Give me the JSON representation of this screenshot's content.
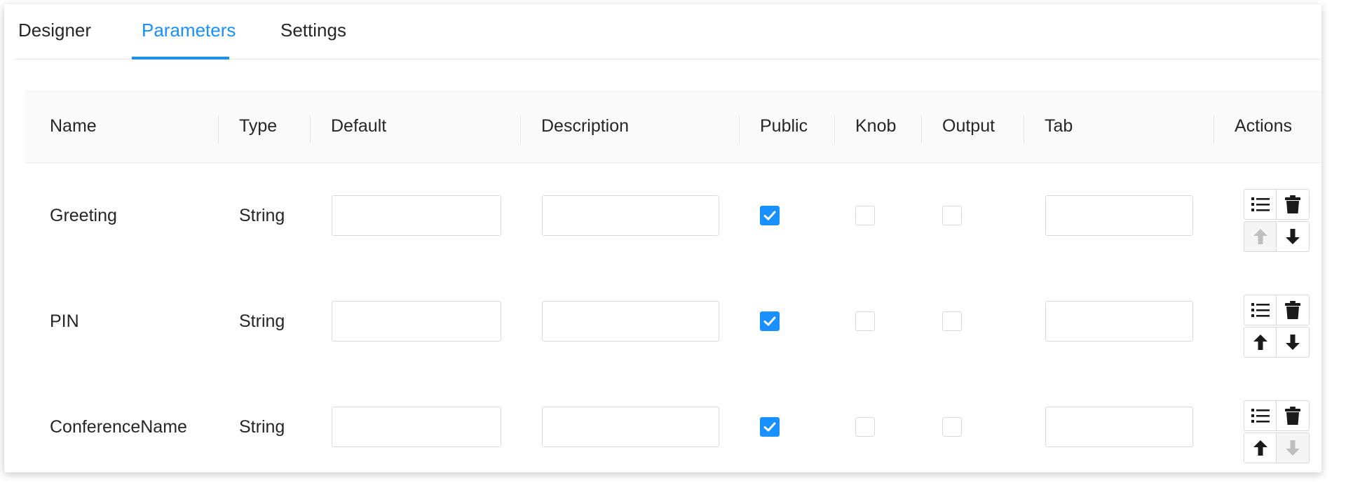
{
  "tabs": [
    {
      "label": "Designer",
      "active": false
    },
    {
      "label": "Parameters",
      "active": true
    },
    {
      "label": "Settings",
      "active": false
    }
  ],
  "table": {
    "columns": [
      "Name",
      "Type",
      "Default",
      "Description",
      "Public",
      "Knob",
      "Output",
      "Tab",
      "Actions"
    ],
    "rows": [
      {
        "name": "Greeting",
        "type": "String",
        "default": "",
        "description": "",
        "public": true,
        "knob": false,
        "output": false,
        "tab": "",
        "move_up_enabled": false,
        "move_down_enabled": true
      },
      {
        "name": "PIN",
        "type": "String",
        "default": "",
        "description": "",
        "public": true,
        "knob": false,
        "output": false,
        "tab": "",
        "move_up_enabled": true,
        "move_down_enabled": true
      },
      {
        "name": "ConferenceName",
        "type": "String",
        "default": "",
        "description": "",
        "public": true,
        "knob": false,
        "output": false,
        "tab": "",
        "move_up_enabled": true,
        "move_down_enabled": false
      }
    ]
  },
  "icons": {
    "edit": "list-icon",
    "delete": "trash-icon",
    "up": "arrow-up-icon",
    "down": "arrow-down-icon"
  },
  "colors": {
    "accent": "#1890ff",
    "disabled_icon": "#bfbfbf",
    "icon": "#1a1a1a"
  }
}
